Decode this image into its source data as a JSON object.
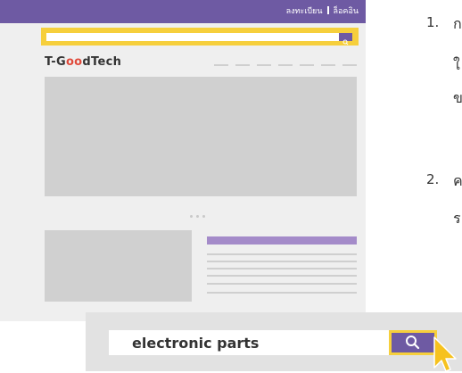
{
  "mockup": {
    "header_links": {
      "register": "ลงทะเบียน",
      "login": "ล็อคอิน"
    },
    "logo": {
      "prefix": "T-G",
      "highlight": "oo",
      "suffix": "dTech"
    },
    "search_button_icon": "search-icon"
  },
  "steps": [
    {
      "number": "1.",
      "lines": [
        "ก",
        "ใ",
        "ข"
      ]
    },
    {
      "number": "2.",
      "lines": [
        "ค",
        "ร"
      ]
    }
  ],
  "zoomed_search": {
    "value": "electronic parts",
    "button_icon": "search-icon"
  },
  "colors": {
    "brand_purple": "#6e5aa3",
    "highlight_yellow": "#f6cf3c",
    "accent_lavender": "#a48bc9",
    "logo_accent": "#e04a3b"
  }
}
